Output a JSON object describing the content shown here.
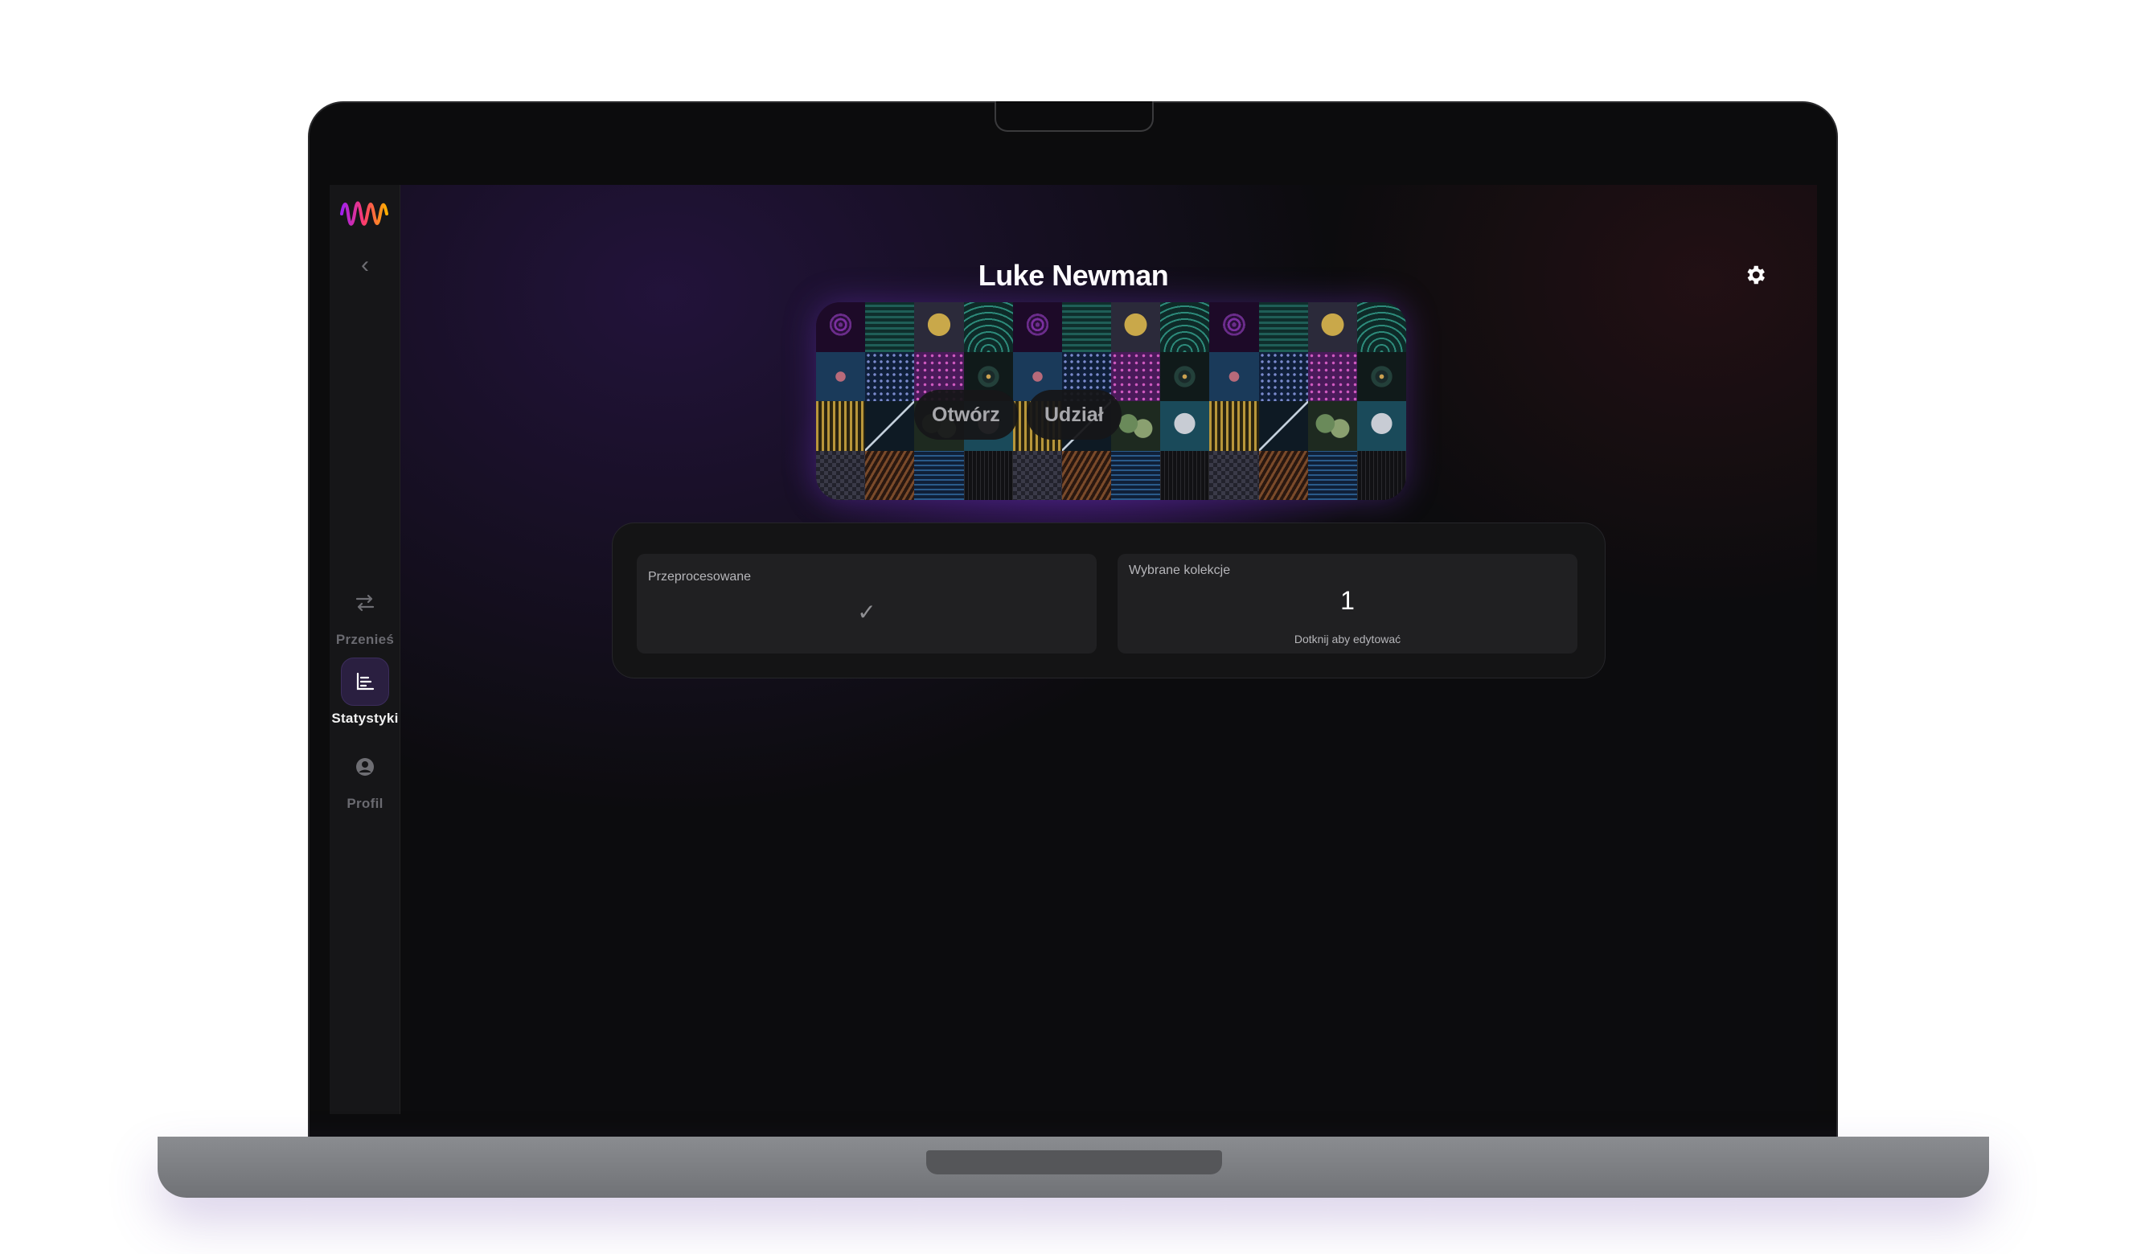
{
  "app": {
    "profile_name": "Luke Newman"
  },
  "sidebar": {
    "items": [
      {
        "label": "Przenieś",
        "icon": "transfer-arrows-icon",
        "active": false
      },
      {
        "label": "Statystyki",
        "icon": "stats-list-icon",
        "active": true
      },
      {
        "label": "Profil",
        "icon": "user-circle-icon",
        "active": false
      }
    ]
  },
  "collage": {
    "open_label": "Otwórz",
    "share_label": "Udział"
  },
  "stats": {
    "processed": {
      "label": "Przeprocesowane",
      "value": "✓"
    },
    "collections": {
      "label": "Wybrane kolekcje",
      "value": "1",
      "hint": "Dotknij aby edytować"
    }
  },
  "colors": {
    "accent": "#7c4dff",
    "active_nav_bg": "#2a1f40",
    "screen_bg": "#0c0c0e"
  }
}
